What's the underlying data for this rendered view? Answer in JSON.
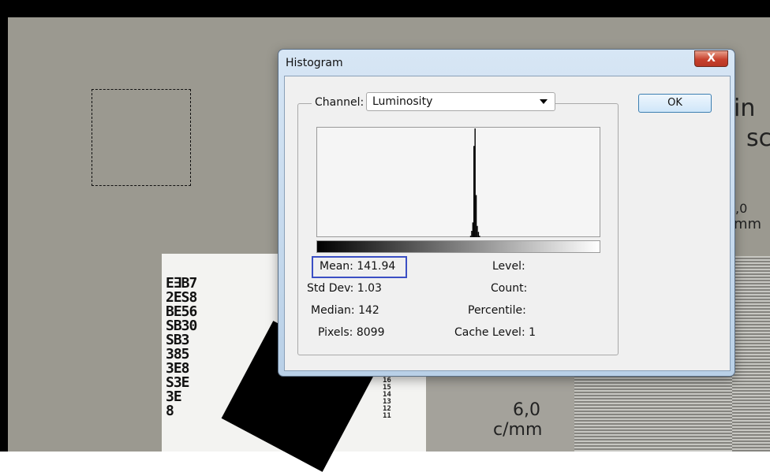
{
  "background": {
    "stack_glyphs": "E∃B7\n2ES8\nBE56\nSB30\nSB3\n385\n3E8\nS3E\n3E\n8",
    "stack_glyphs_small": "16\n15\n14\n13\n12\n11",
    "freq_value": "6,0",
    "freq_unit": "c/mm",
    "partial_text_1": "in",
    "partial_text_2": "sc",
    "partial_text_3": ",0",
    "partial_text_4": "mm"
  },
  "dialog": {
    "title": "Histogram",
    "close_symbol": "X",
    "ok_label": "OK",
    "channel": {
      "label": "Channel:",
      "value": "Luminosity"
    },
    "stats": {
      "mean_label": "Mean:",
      "mean_value": "141.94",
      "stddev_label": "Std Dev:",
      "stddev_value": "1.03",
      "median_label": "Median:",
      "median_value": "142",
      "pixels_label": "Pixels:",
      "pixels_value": "8099",
      "level_label": "Level:",
      "count_label": "Count:",
      "percentile_label": "Percentile:",
      "cache_label": "Cache Level:",
      "cache_value": "1"
    }
  },
  "histogram": {
    "bins": [
      138,
      139,
      140,
      141,
      142,
      143,
      144,
      145,
      146
    ],
    "counts": [
      40,
      180,
      420,
      2600,
      3100,
      1200,
      320,
      150,
      40
    ],
    "max_count": 3100,
    "x_range": [
      0,
      255
    ]
  },
  "colors": {
    "highlight_box": "#3b4fc4",
    "close_button": "#c7412d",
    "ok_button_border": "#3c7fb1"
  }
}
